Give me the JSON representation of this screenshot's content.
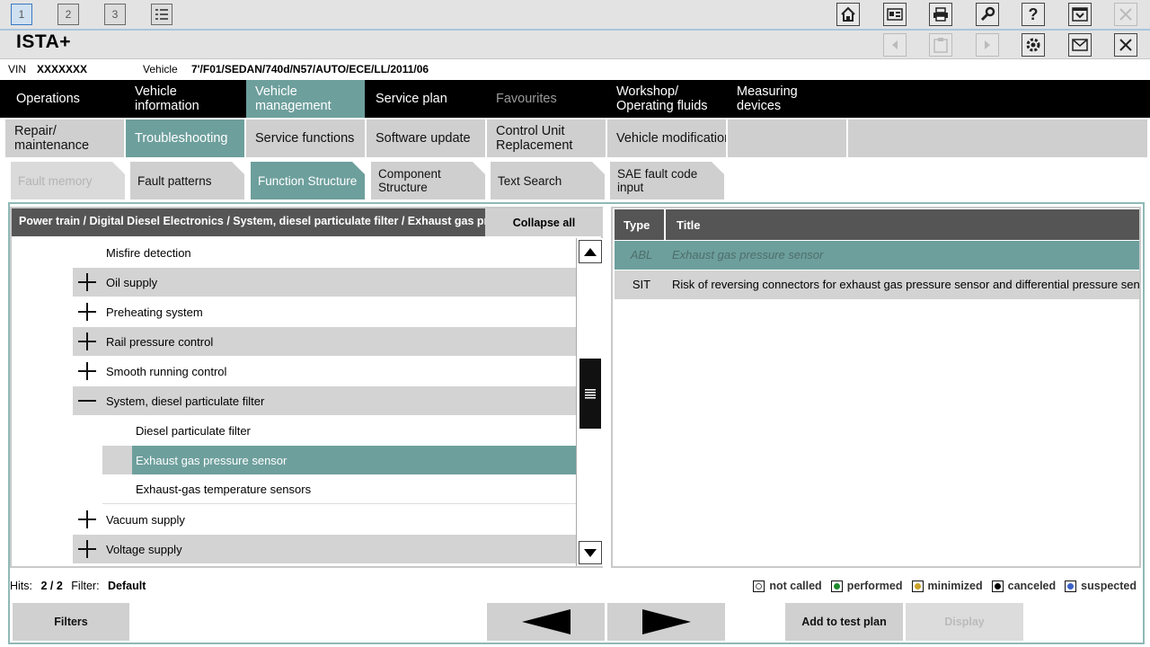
{
  "window": {
    "workspaces": [
      "1",
      "2",
      "3"
    ],
    "toolbar_icons": [
      "home-icon",
      "id-card-icon",
      "print-icon",
      "wrench-icon",
      "help-icon",
      "minimize-icon",
      "close-icon"
    ],
    "secondary_icons": [
      "back-icon",
      "clipboard-icon",
      "forward-icon",
      "gear-icon",
      "mail-icon",
      "close-icon"
    ]
  },
  "app": {
    "title": "ISTA+"
  },
  "vehicle_line": {
    "vin_label": "VIN",
    "vin_value": "XXXXXXX",
    "vehicle_label": "Vehicle",
    "vehicle_value": "7'/F01/SEDAN/740d/N57/AUTO/ECE/LL/2011/06"
  },
  "nav_main": [
    {
      "label": "Operations"
    },
    {
      "label": "Vehicle information"
    },
    {
      "label": "Vehicle management"
    },
    {
      "label": "Service plan"
    },
    {
      "label": "Favourites"
    },
    {
      "label": "Workshop/ Operating fluids"
    },
    {
      "label": "Measuring devices"
    }
  ],
  "nav_sub": [
    {
      "label": "Repair/ maintenance"
    },
    {
      "label": "Troubleshooting"
    },
    {
      "label": "Service functions"
    },
    {
      "label": "Software update"
    },
    {
      "label": "Control Unit Replacement"
    },
    {
      "label": "Vehicle modification"
    }
  ],
  "nav_tabs": [
    {
      "label": "Fault memory"
    },
    {
      "label": "Fault patterns"
    },
    {
      "label": "Function Structure"
    },
    {
      "label": "Component Structure"
    },
    {
      "label": "Text Search"
    },
    {
      "label": "SAE fault code input"
    }
  ],
  "tree": {
    "breadcrumb": "Power train / Digital Diesel Electronics / System, diesel particulate filter / Exhaust gas pressure sensor",
    "collapse_label": "Collapse all",
    "items": [
      {
        "label": "Misfire detection"
      },
      {
        "label": "Oil supply"
      },
      {
        "label": "Preheating system"
      },
      {
        "label": "Rail pressure control"
      },
      {
        "label": "Smooth running control"
      },
      {
        "label": "System, diesel particulate filter"
      },
      {
        "label": "Diesel particulate filter"
      },
      {
        "label": "Exhaust gas pressure sensor"
      },
      {
        "label": "Exhaust-gas temperature sensors"
      },
      {
        "label": "Vacuum supply"
      },
      {
        "label": "Voltage supply"
      }
    ]
  },
  "results": {
    "col_type": "Type",
    "col_title": "Title",
    "rows": [
      {
        "type": "ABL",
        "title": "Exhaust gas pressure sensor"
      },
      {
        "type": "SIT",
        "title": "Risk of reversing connectors for exhaust gas pressure sensor and differential pressure sensor"
      }
    ]
  },
  "status": {
    "hits_label": "Hits:",
    "hits_value": "2 / 2",
    "filter_label": "Filter:",
    "filter_value": "Default"
  },
  "legend": [
    {
      "label": "not called",
      "color": "#ffffff"
    },
    {
      "label": "performed",
      "color": "#1e8a2e"
    },
    {
      "label": "minimized",
      "color": "#c9a227"
    },
    {
      "label": "canceled",
      "color": "#000000"
    },
    {
      "label": "suspected",
      "color": "#3a5fc8"
    }
  ],
  "buttons": {
    "filters": "Filters",
    "add_to_test_plan": "Add to test plan",
    "display": "Display"
  },
  "colors": {
    "accent": "#6d9f9c",
    "nav_dark": "#000000",
    "header_grey": "#555555"
  }
}
